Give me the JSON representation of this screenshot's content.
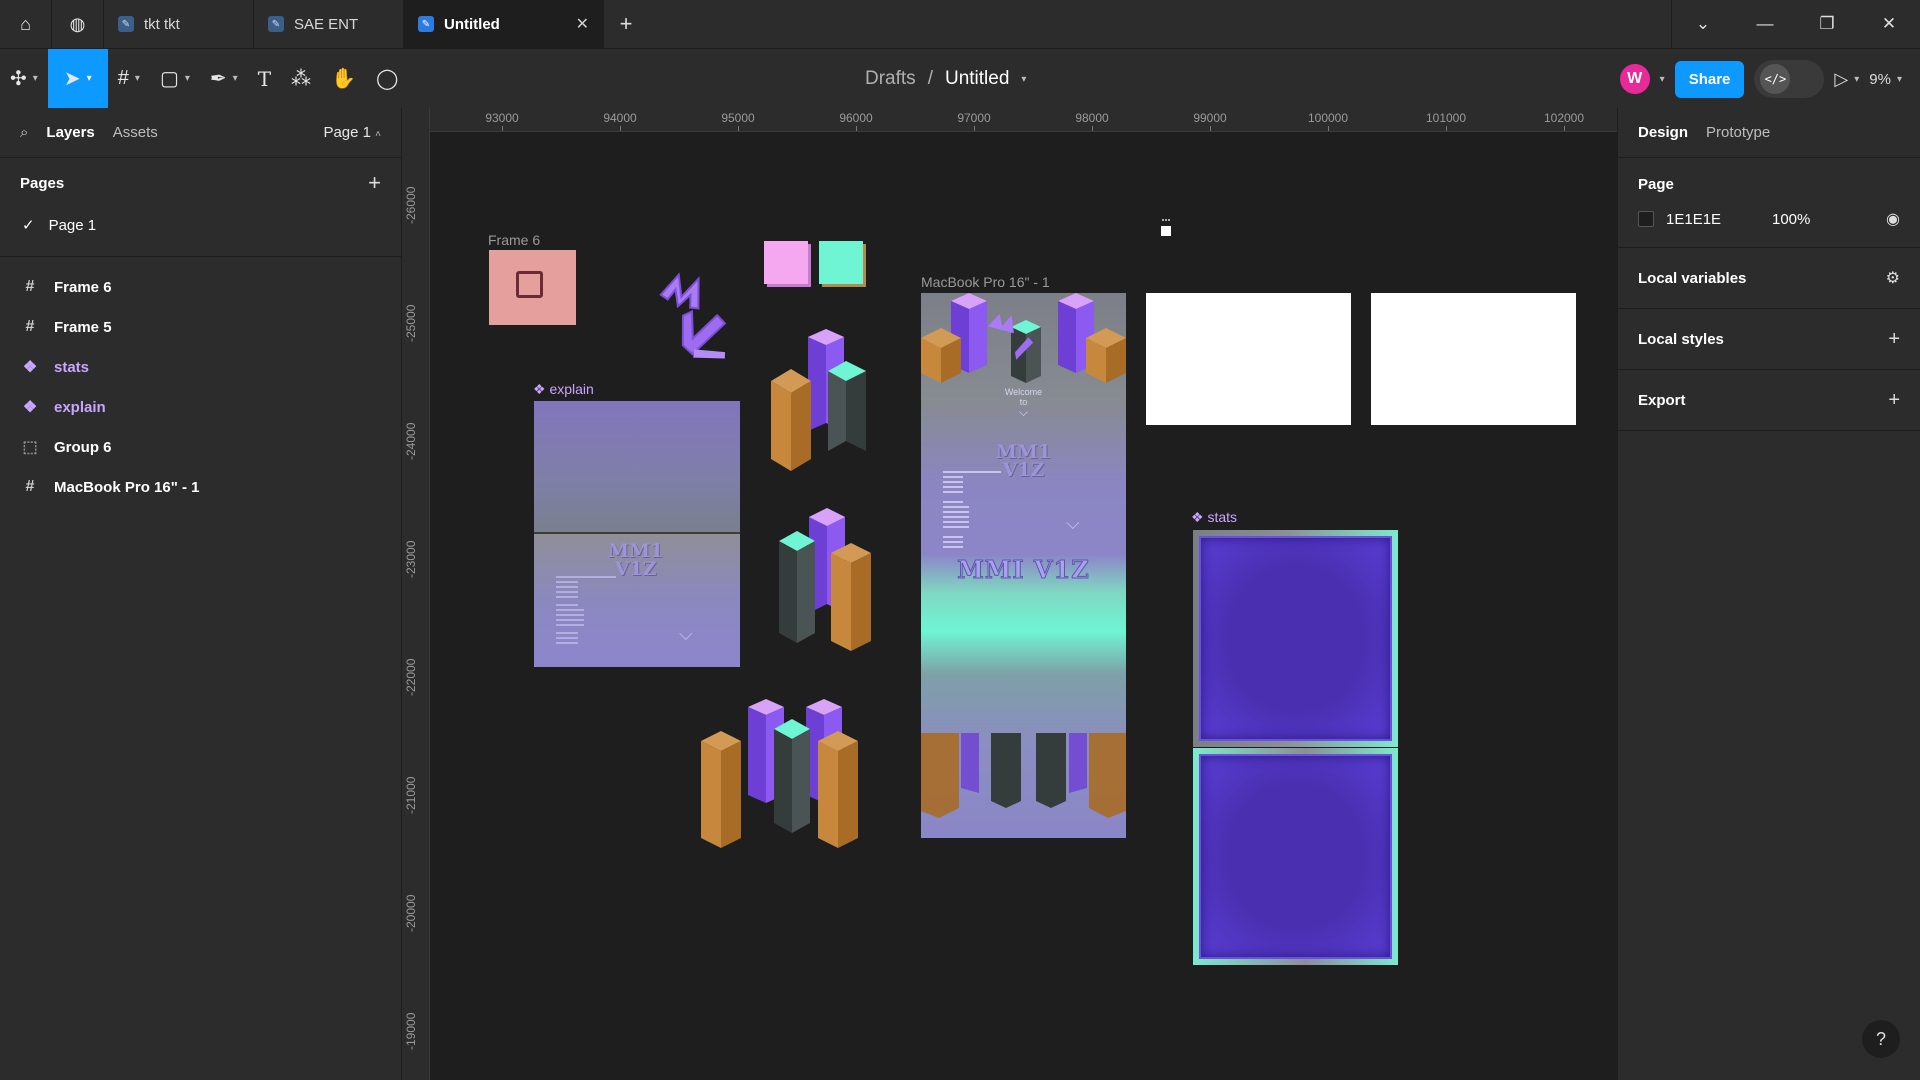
{
  "tabs": [
    {
      "label": "tkt tkt"
    },
    {
      "label": "SAE ENT"
    },
    {
      "label": "Untitled"
    }
  ],
  "breadcrumb": {
    "parent": "Drafts",
    "separator": "/",
    "current": "Untitled"
  },
  "toolbar": {
    "share_label": "Share",
    "avatar_initial": "W",
    "zoom": "9%",
    "dev_mode_glyph": "</>"
  },
  "left_panel": {
    "tab_layers": "Layers",
    "tab_assets": "Assets",
    "page_selector": "Page 1",
    "pages_title": "Pages",
    "pages": [
      {
        "label": "Page 1"
      }
    ],
    "layers": [
      {
        "label": "Frame 6",
        "kind": "frame"
      },
      {
        "label": "Frame 5",
        "kind": "frame"
      },
      {
        "label": "stats",
        "kind": "component"
      },
      {
        "label": "explain",
        "kind": "component"
      },
      {
        "label": "Group 6",
        "kind": "group"
      },
      {
        "label": "MacBook Pro 16\" - 1",
        "kind": "frame"
      }
    ]
  },
  "rulers": {
    "top": [
      "93000",
      "94000",
      "95000",
      "96000",
      "97000",
      "98000",
      "99000",
      "100000",
      "101000",
      "102000"
    ],
    "left": [
      "-26000",
      "-25000",
      "-24000",
      "-23000",
      "-22000",
      "-21000",
      "-20000",
      "-19000"
    ]
  },
  "canvas": {
    "frame6_label": "Frame 6",
    "explain_label": "explain",
    "macbook_label": "MacBook Pro 16\" - 1",
    "stats_label": "stats",
    "welcome_text": "Welcome",
    "to_text": "to",
    "mmi_viz_title": "MMI V1Z",
    "mmi_stack_line1": "MM1",
    "mmi_stack_line2": "V1Z"
  },
  "right_panel": {
    "tab_design": "Design",
    "tab_prototype": "Prototype",
    "page_section_title": "Page",
    "page_color": "1E1E1E",
    "page_opacity": "100%",
    "local_variables": "Local variables",
    "local_styles": "Local styles",
    "export": "Export"
  },
  "colors": {
    "accent": "#0d99ff",
    "component": "#c7a6ff",
    "canvas_bg": "#1e1e1e",
    "panel_bg": "#2c2c2c"
  }
}
